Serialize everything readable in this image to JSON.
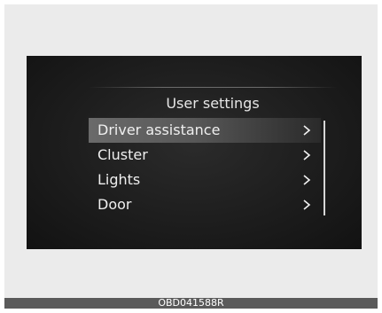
{
  "screen": {
    "title": "User settings",
    "menu": [
      {
        "label": "Driver assistance",
        "arrow": ">",
        "selected": true
      },
      {
        "label": "Cluster",
        "arrow": ">",
        "selected": false
      },
      {
        "label": "Lights",
        "arrow": ">",
        "selected": false
      },
      {
        "label": "Door",
        "arrow": ">",
        "selected": false
      }
    ]
  },
  "caption": "OBD041588R",
  "colors": {
    "screen_bg": "#1d1d1d",
    "selected_bg": "#6a6a6a",
    "text": "#efefef",
    "caption_bar": "#5a5a5a"
  }
}
